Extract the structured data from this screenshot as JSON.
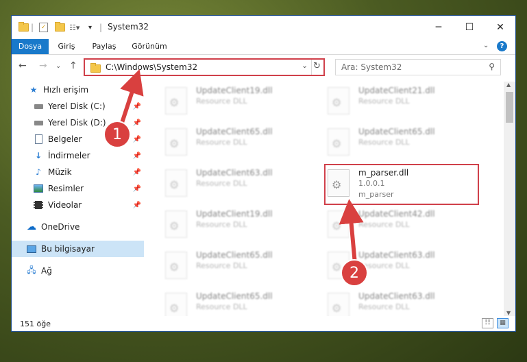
{
  "window": {
    "title": "System32"
  },
  "ribbon": {
    "tabs": [
      "Dosya",
      "Giriş",
      "Paylaş",
      "Görünüm"
    ]
  },
  "address": {
    "path": "C:\\Windows\\System32"
  },
  "search": {
    "placeholder": "Ara: System32"
  },
  "sidebar": {
    "items": [
      {
        "label": "Hızlı erişim",
        "icon": "star-icon",
        "pinned": false
      },
      {
        "label": "Yerel Disk (C:)",
        "icon": "drive-icon",
        "pinned": true
      },
      {
        "label": "Yerel Disk (D:)",
        "icon": "drive-icon",
        "pinned": true
      },
      {
        "label": "Belgeler",
        "icon": "documents-icon",
        "pinned": true
      },
      {
        "label": "İndirmeler",
        "icon": "download-icon",
        "pinned": true
      },
      {
        "label": "Müzik",
        "icon": "music-icon",
        "pinned": true
      },
      {
        "label": "Resimler",
        "icon": "pictures-icon",
        "pinned": true
      },
      {
        "label": "Videolar",
        "icon": "videos-icon",
        "pinned": true
      },
      {
        "label": "OneDrive",
        "icon": "cloud-icon",
        "pinned": false
      },
      {
        "label": "Bu bilgisayar",
        "icon": "computer-icon",
        "pinned": false,
        "selected": true
      },
      {
        "label": "Ağ",
        "icon": "network-icon",
        "pinned": false
      }
    ]
  },
  "files": {
    "left": [
      {
        "name": "UpdateClient19.dll",
        "type": "Resource DLL"
      },
      {
        "name": "UpdateClient65.dll",
        "type": "Resource DLL"
      },
      {
        "name": "UpdateClient63.dll",
        "type": "Resource DLL"
      },
      {
        "name": "UpdateClient19.dll",
        "type": "Resource DLL"
      },
      {
        "name": "UpdateClient65.dll",
        "type": "Resource DLL"
      },
      {
        "name": "UpdateClient65.dll",
        "type": "Resource DLL"
      }
    ],
    "right": [
      {
        "name": "UpdateClient21.dll",
        "type": "Resource DLL"
      },
      {
        "name": "UpdateClient65.dll",
        "type": "Resource DLL"
      },
      {
        "name": "m_parser.dll",
        "type": "1.0.0.1",
        "desc": "m_parser",
        "highlighted": true
      },
      {
        "name": "UpdateClient42.dll",
        "type": "Resource DLL"
      },
      {
        "name": "UpdateClient63.dll",
        "type": "Resource DLL"
      },
      {
        "name": "UpdateClient63.dll",
        "type": "Resource DLL"
      }
    ]
  },
  "status": {
    "count": "151 öğe"
  },
  "annotations": {
    "step1": "1",
    "step2": "2",
    "color": "#d9403f"
  }
}
